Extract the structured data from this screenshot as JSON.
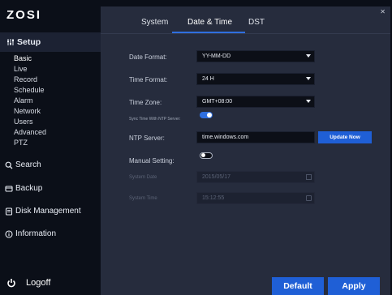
{
  "brand": "ZOSI",
  "sidebar": {
    "setup": {
      "label": "Setup",
      "icon": "settings-sliders-icon"
    },
    "setup_items": [
      "Basic",
      "Live",
      "Record",
      "Schedule",
      "Alarm",
      "Network",
      "Users",
      "Advanced",
      "PTZ"
    ],
    "search": {
      "label": "Search",
      "icon": "search-icon"
    },
    "backup": {
      "label": "Backup",
      "icon": "backup-icon"
    },
    "disk": {
      "label": "Disk Management",
      "icon": "disk-icon"
    },
    "info": {
      "label": "Information",
      "icon": "info-icon"
    },
    "logoff": {
      "label": "Logoff",
      "icon": "power-icon"
    }
  },
  "tabs": [
    "System",
    "Date & Time",
    "DST"
  ],
  "form": {
    "date_format": {
      "label": "Date Format:",
      "value": "YY-MM-DD"
    },
    "time_format": {
      "label": "Time Format:",
      "value": "24 H"
    },
    "time_zone": {
      "label": "Time Zone:",
      "value": "GMT+08:00"
    },
    "ntp_sync": {
      "label": "Sync Time With NTP Server:",
      "on": true
    },
    "ntp_server": {
      "label": "NTP Server:",
      "value": "time.windows.com",
      "button": "Update Now"
    },
    "manual": {
      "label": "Manual Setting:",
      "on": false
    },
    "system_date": {
      "label": "System Date",
      "value": "2015/05/17"
    },
    "system_time": {
      "label": "System Time",
      "value": "15:12:55"
    }
  },
  "actions": {
    "default": "Default",
    "apply": "Apply"
  },
  "colors": {
    "accent": "#2f6fe0",
    "panel": "#262c3d",
    "sidebar": "#0b0f18"
  }
}
